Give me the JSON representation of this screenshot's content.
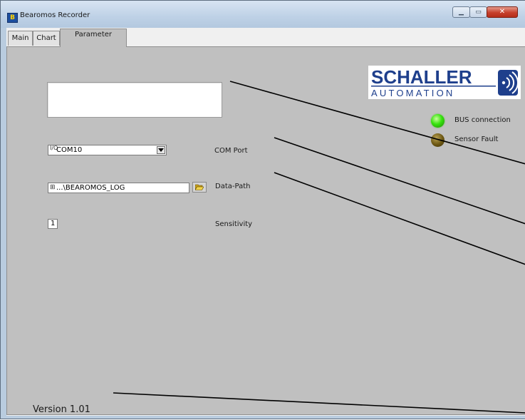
{
  "window": {
    "title": "Bearomos Recorder",
    "minimize_symbol": "▁",
    "maximize_symbol": "▭",
    "close_symbol": "✕"
  },
  "tabs": [
    {
      "label": "Main"
    },
    {
      "label": "Chart"
    },
    {
      "label": "Parameter",
      "selected": true
    }
  ],
  "logo": {
    "line1": "SCHALLER",
    "line2": "AUTOMATION",
    "brand_color": "#1e3f8c"
  },
  "indicators": [
    {
      "label": "BUS connection",
      "state": "on",
      "color": "#37e30f"
    },
    {
      "label": "Sensor Fault",
      "state": "off",
      "color": "#6b5612"
    }
  ],
  "parameters": {
    "com_port": {
      "io_icon": "I/O",
      "value": "COM10",
      "label": "COM Port"
    },
    "data_path": {
      "value": "...\\BEAROMOS_LOG",
      "label": "Data-Path"
    },
    "sensitivity": {
      "value": "1",
      "label": "Sensitivity"
    }
  },
  "message": {
    "value": ""
  },
  "version": "Version 1.01",
  "colors": {
    "panel": "#c0c0c0",
    "titlebar": "#bed1e6"
  }
}
